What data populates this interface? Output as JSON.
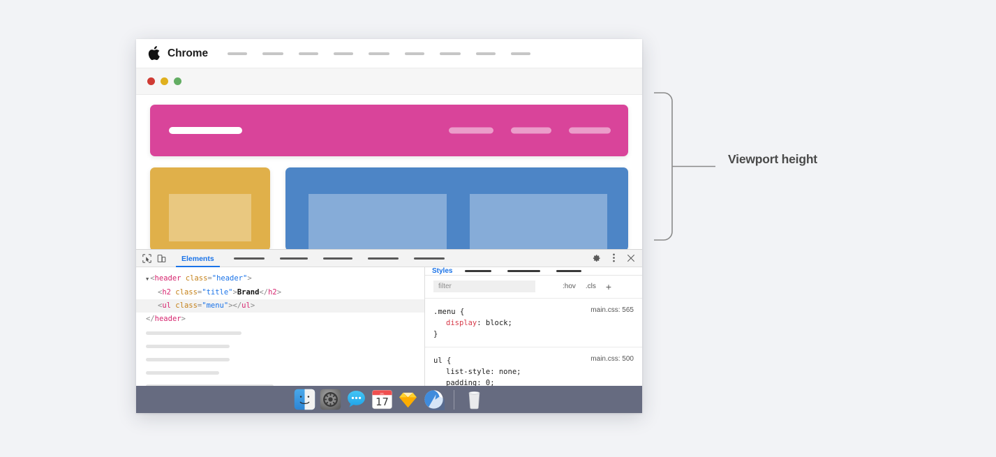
{
  "window": {
    "menubar": {
      "app_name": "Chrome",
      "apple_logo_icon": "apple-logo-icon",
      "menu_placeholder_widths": [
        28,
        30,
        28,
        28,
        30,
        28,
        30,
        28,
        28
      ]
    },
    "traffic_lights": [
      {
        "name": "close-button",
        "color": "#cf3b34"
      },
      {
        "name": "minimize-button",
        "color": "#e0b01e"
      },
      {
        "name": "zoom-button",
        "color": "#63ad63"
      }
    ],
    "page": {
      "hero": {
        "color": "#d9449a",
        "brand_placeholder": "brand-bar",
        "nav_placeholder_widths": [
          64,
          58,
          60
        ]
      },
      "card_left": {
        "color": "#e0b04a"
      },
      "card_right": {
        "color": "#4d85c6"
      }
    }
  },
  "devtools": {
    "toolbar": {
      "inspect_icon": "inspect-element-icon",
      "device_icon": "device-toolbar-icon",
      "active_tab": "Elements",
      "tab_placeholder_widths": [
        44,
        40,
        42,
        44,
        44
      ],
      "settings_icon": "gear-icon",
      "more_icon": "kebab-menu-icon",
      "close_icon": "close-icon"
    },
    "dom_tree": {
      "lines": [
        {
          "indent": 0,
          "triangle": true,
          "tokens": [
            {
              "t": "brk",
              "v": "<"
            },
            {
              "t": "tag",
              "v": "header"
            },
            {
              "t": "attr",
              "v": " class"
            },
            {
              "t": "brk",
              "v": "="
            },
            {
              "t": "val",
              "v": "\"header\""
            },
            {
              "t": "brk",
              "v": ">"
            }
          ]
        },
        {
          "indent": 1,
          "triangle": false,
          "tokens": [
            {
              "t": "brk",
              "v": "<"
            },
            {
              "t": "tag",
              "v": "h2"
            },
            {
              "t": "attr",
              "v": " class"
            },
            {
              "t": "brk",
              "v": "="
            },
            {
              "t": "val",
              "v": "\"title\""
            },
            {
              "t": "brk",
              "v": ">"
            },
            {
              "t": "txt",
              "v": "Brand"
            },
            {
              "t": "brk",
              "v": "</"
            },
            {
              "t": "tag",
              "v": "h2"
            },
            {
              "t": "brk",
              "v": ">"
            }
          ]
        },
        {
          "indent": 1,
          "triangle": false,
          "selected": true,
          "tokens": [
            {
              "t": "brk",
              "v": "<"
            },
            {
              "t": "tag",
              "v": "ul"
            },
            {
              "t": "attr",
              "v": " class"
            },
            {
              "t": "brk",
              "v": "="
            },
            {
              "t": "val",
              "v": "\"menu\""
            },
            {
              "t": "brk",
              "v": "></"
            },
            {
              "t": "tag",
              "v": "ul"
            },
            {
              "t": "brk",
              "v": ">"
            }
          ]
        },
        {
          "indent": 0,
          "triangle": false,
          "tokens": [
            {
              "t": "brk",
              "v": "</"
            },
            {
              "t": "tag",
              "v": "header"
            },
            {
              "t": "brk",
              "v": ">"
            }
          ]
        }
      ],
      "placeholder_line_widths": [
        137,
        120,
        120,
        105,
        183,
        221,
        248
      ]
    },
    "styles": {
      "title": "Styles",
      "tab_placeholder_widths": [
        38,
        47,
        36
      ],
      "filter_placeholder": "filter",
      "hov_label": ":hov",
      "cls_label": ".cls",
      "add_label": "+",
      "rules": [
        {
          "selector": ".menu {",
          "source": "main.css: 565",
          "declarations": [
            {
              "property": "display",
              "value": ": block;",
              "highlight": true
            }
          ],
          "close": "}"
        },
        {
          "selector": "ul {",
          "source": "main.css: 500",
          "declarations": [
            {
              "property": "list-style",
              "value": ": none;",
              "highlight": false
            },
            {
              "property": "padding",
              "value": ": 0;",
              "highlight": false
            }
          ],
          "close": ""
        }
      ]
    }
  },
  "dock": {
    "icons": [
      "finder-icon",
      "system-preferences-icon",
      "messages-icon",
      "calendar-icon",
      "sketch-icon",
      "sparrow-icon"
    ],
    "trash_icon": "trash-icon",
    "calendar_day": "17",
    "calendar_month": "JUL"
  },
  "annotation": {
    "label": "Viewport height",
    "bracket_color": "#8a8a8a"
  }
}
